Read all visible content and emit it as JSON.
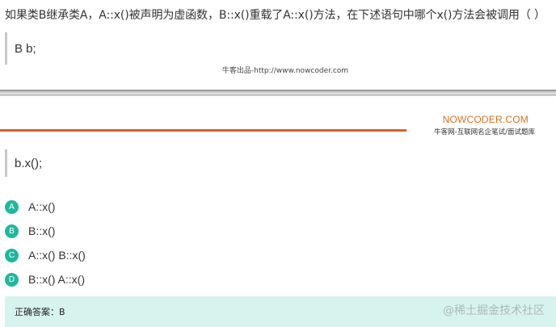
{
  "question": {
    "text": "如果类B继承类A，A::x()被声明为虚函数，B::x()重载了A::x()方法，在下述语句中哪个x()方法会被调用（ ）"
  },
  "code_top": "B b;",
  "source_credit": "牛客出品-http://www.nowcoder.com",
  "brand": {
    "name": "NOWCODER.COM",
    "tagline": "牛客网-互联网名企笔试/面试题库",
    "accent_color": "#d4622a"
  },
  "code_mid": "b.x();",
  "options": [
    {
      "letter": "A",
      "text": "A::x()"
    },
    {
      "letter": "B",
      "text": "B::x()"
    },
    {
      "letter": "C",
      "text": "A::x()  B::x()"
    },
    {
      "letter": "D",
      "text": "B::x()  A::x()"
    }
  ],
  "answer": {
    "label": "正确答案：B"
  },
  "watermark": "@稀土掘金技术社区",
  "colors": {
    "option_badge": "#1fb89a",
    "answer_bg": "#d6f3ee"
  }
}
